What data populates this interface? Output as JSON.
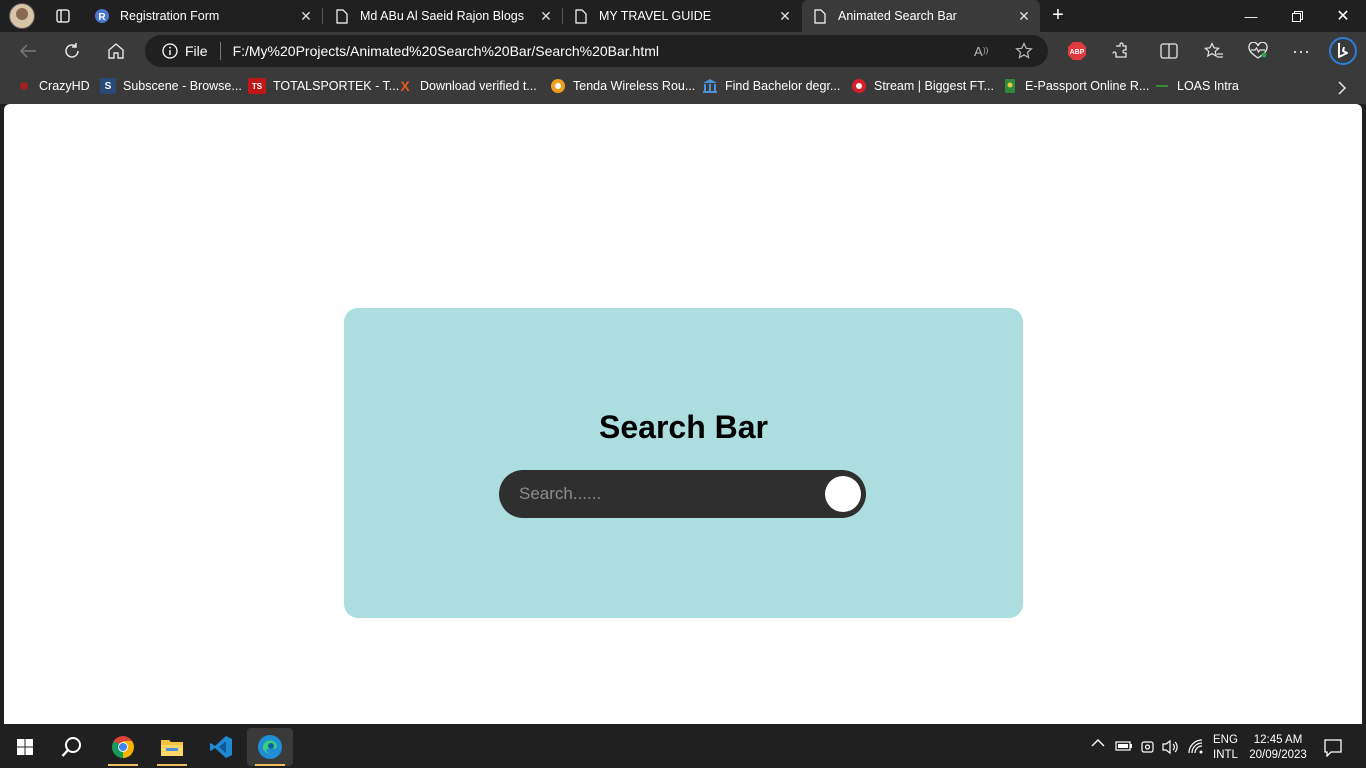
{
  "tabs": [
    {
      "title": "Registration Form",
      "active": false
    },
    {
      "title": "Md ABu Al Saeid Rajon Blogs",
      "active": false
    },
    {
      "title": "MY TRAVEL GUIDE",
      "active": false
    },
    {
      "title": "Animated Search Bar",
      "active": true
    }
  ],
  "address": {
    "protocol": "File",
    "url": "F:/My%20Projects/Animated%20Search%20Bar/Search%20Bar.html"
  },
  "bookmarks": [
    {
      "label": "CrazyHD",
      "icon": "crazyhd-icon"
    },
    {
      "label": "Subscene - Browse...",
      "icon": "subscene-icon"
    },
    {
      "label": "TOTALSPORTEK - T...",
      "icon": "totalsportek-icon"
    },
    {
      "label": "Download verified t...",
      "icon": "x-icon"
    },
    {
      "label": "Tenda Wireless Rou...",
      "icon": "tenda-icon"
    },
    {
      "label": "Find Bachelor degr...",
      "icon": "university-icon"
    },
    {
      "label": "Stream | Biggest FT...",
      "icon": "stream-icon"
    },
    {
      "label": "E-Passport Online R...",
      "icon": "passport-icon"
    },
    {
      "label": "LOAS Intra",
      "icon": "loas-icon"
    }
  ],
  "extensions": {
    "abp_label": "ABP"
  },
  "page": {
    "heading": "Search Bar",
    "search_placeholder": "Search......"
  },
  "tray": {
    "lang1": "ENG",
    "lang2": "INTL",
    "time": "12:45 AM",
    "date": "20/09/2023"
  },
  "colors": {
    "card_bg": "#acdedf",
    "search_bg": "#2f2f2f",
    "knob": "#ffffff",
    "chrome_dark": "#202020",
    "chrome_mid": "#3a3a3a"
  }
}
